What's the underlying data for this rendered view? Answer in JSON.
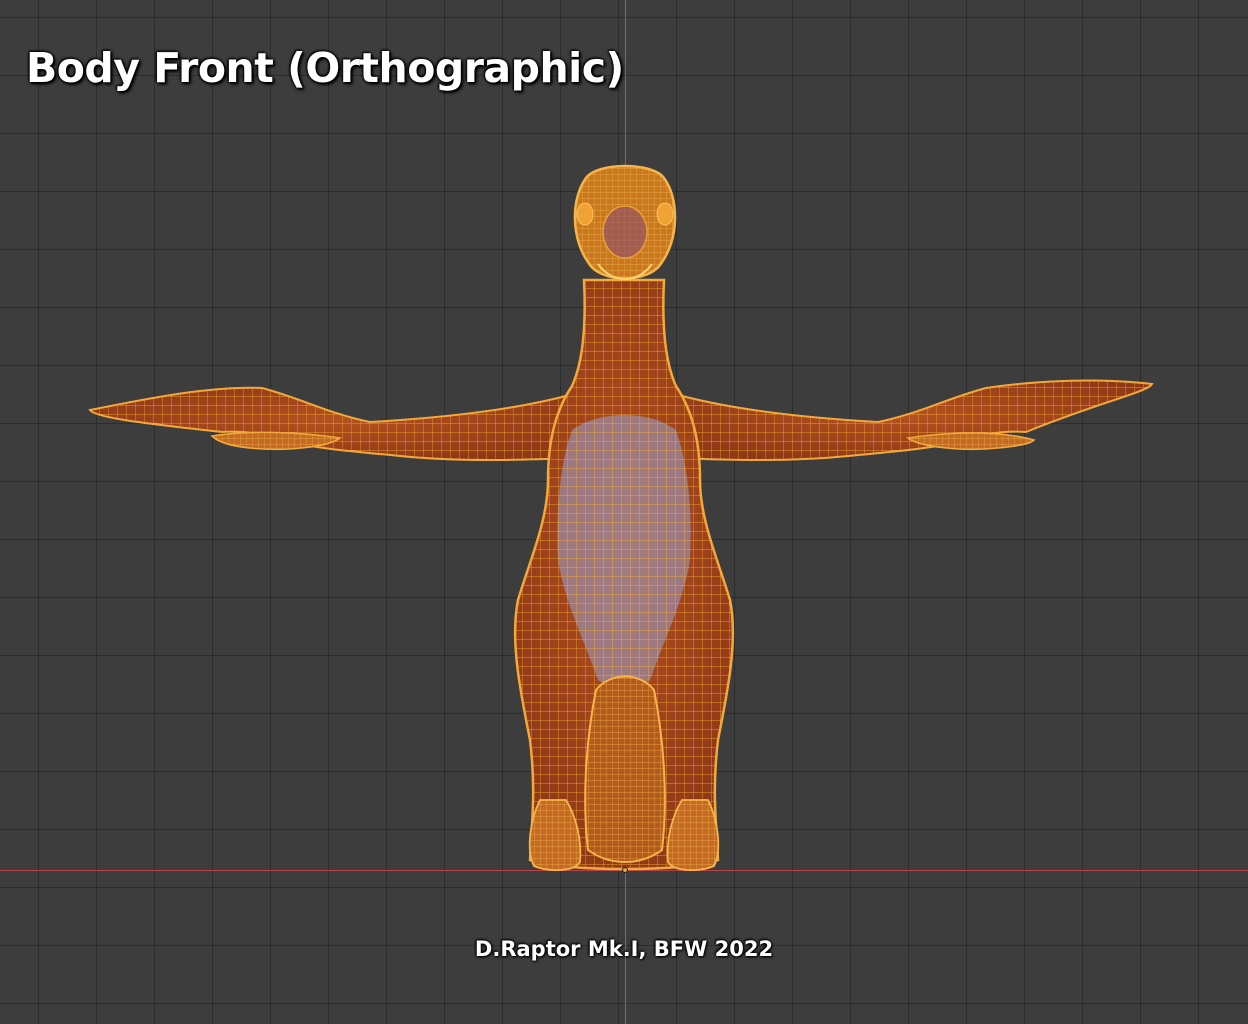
{
  "viewport": {
    "title": "Body Front (Orthographic)",
    "credit": "D.Raptor Mk.I, BFW 2022"
  },
  "colors": {
    "background": "#3d3d3d",
    "grid_line": "#2f2f2f",
    "x_axis": "#b5414b",
    "z_axis": "#3f79bd",
    "wire": "#f2a93a",
    "skin": "#a8451c",
    "belly": "#9b8aa0"
  },
  "model": {
    "name": "raptor-body-mesh",
    "view": "front-orthographic",
    "display": "wireframe-overlay"
  }
}
